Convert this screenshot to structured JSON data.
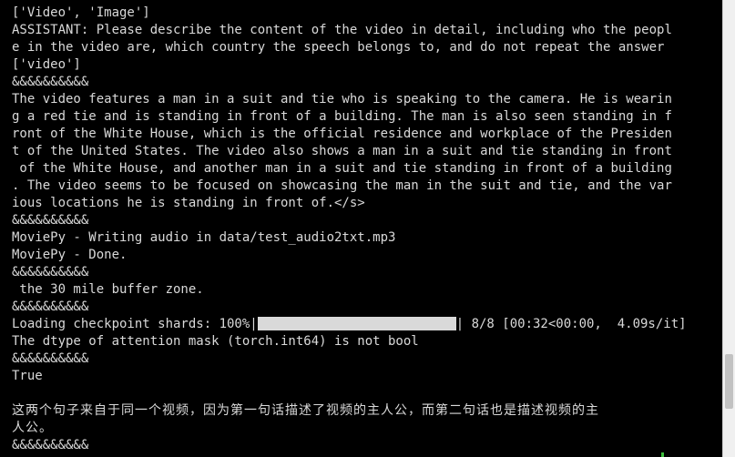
{
  "terminal": {
    "lines": [
      "['Video', 'Image']",
      "ASSISTANT: Please describe the content of the video in detail, including who the peopl",
      "e in the video are, which country the speech belongs to, and do not repeat the answer",
      "['video']",
      "&&&&&&&&&&",
      "The video features a man in a suit and tie who is speaking to the camera. He is wearin",
      "g a red tie and is standing in front of a building. The man is also seen standing in f",
      "ront of the White House, which is the official residence and workplace of the Presiden",
      "t of the United States. The video also shows a man in a suit and tie standing in front",
      " of the White House, and another man in a suit and tie standing in front of a building",
      ". The video seems to be focused on showcasing the man in the suit and tie, and the var",
      "ious locations he is standing in front of.</s>",
      "&&&&&&&&&&",
      "MoviePy - Writing audio in data/test_audio2txt.mp3",
      "MoviePy - Done.",
      "&&&&&&&&&&",
      " the 30 mile buffer zone.",
      "&&&&&&&&&&"
    ],
    "progress": {
      "prefix": "Loading checkpoint shards: 100%|",
      "fraction": 1.0,
      "suffix": "| 8/8 [00:32<00:00,  4.09s/it]"
    },
    "lines_after": [
      "The dtype of attention mask (torch.int64) is not bool",
      "&&&&&&&&&&",
      "True",
      "",
      "这两个句子来自于同一个视频，因为第一句话描述了视频的主人公，而第二句话也是描述视频的主",
      "人公。",
      "&&&&&&&&&&"
    ],
    "scroll_position": 0.88
  }
}
